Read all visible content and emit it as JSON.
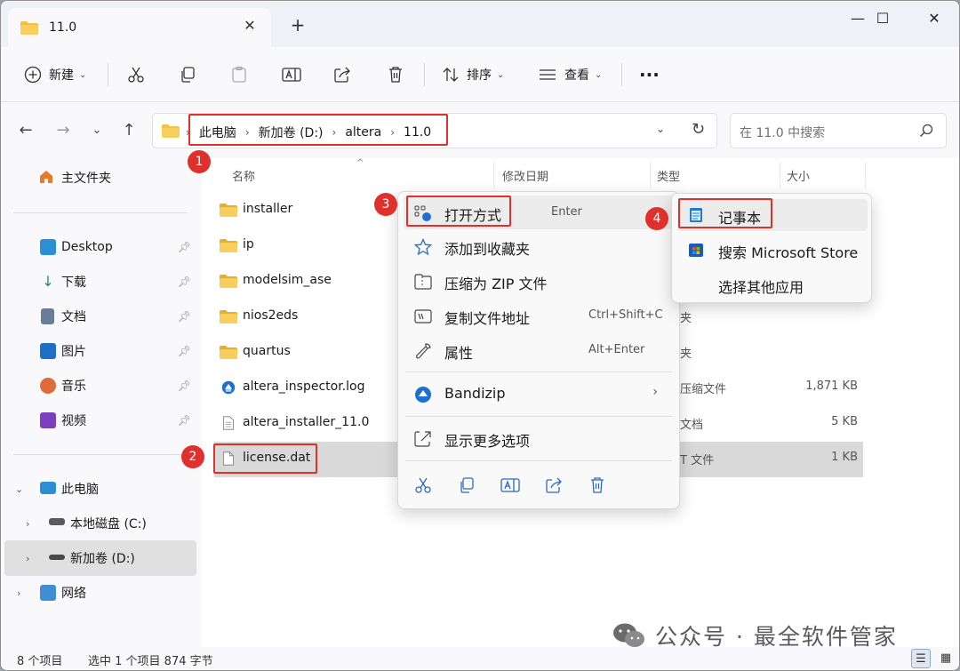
{
  "window": {
    "tab_title": "11.0",
    "new_tab_symbol": "+",
    "controls": {
      "minimize": "—",
      "maximize": "☐",
      "close": "✕"
    }
  },
  "toolbar": {
    "new_label": "新建",
    "sort_label": "排序",
    "view_label": "查看",
    "more_label": "···"
  },
  "address": {
    "crumbs": [
      "此电脑",
      "新加卷 (D:)",
      "altera",
      "11.0"
    ],
    "search_placeholder": "在 11.0 中搜索"
  },
  "sidebar": {
    "home": "主文件夹",
    "quick": [
      {
        "label": "Desktop",
        "icon": "desktop-icon"
      },
      {
        "label": "下载",
        "icon": "download-icon"
      },
      {
        "label": "文档",
        "icon": "documents-icon"
      },
      {
        "label": "图片",
        "icon": "pictures-icon"
      },
      {
        "label": "音乐",
        "icon": "music-icon"
      },
      {
        "label": "视频",
        "icon": "videos-icon"
      }
    ],
    "this_pc": "此电脑",
    "drives": [
      "本地磁盘 (C:)",
      "新加卷 (D:)"
    ],
    "network": "网络"
  },
  "columns": {
    "name": "名称",
    "modified": "修改日期",
    "type": "类型",
    "size": "大小"
  },
  "files": [
    {
      "name": "installer",
      "kind": "folder",
      "type": "",
      "size": ""
    },
    {
      "name": "ip",
      "kind": "folder",
      "type": "",
      "size": ""
    },
    {
      "name": "modelsim_ase",
      "kind": "folder",
      "type": "",
      "size": ""
    },
    {
      "name": "nios2eds",
      "kind": "folder",
      "type": "夹",
      "size": ""
    },
    {
      "name": "quartus",
      "kind": "folder",
      "type": "夹",
      "size": ""
    },
    {
      "name": "altera_inspector.log",
      "kind": "zip",
      "type": "压缩文件",
      "size": "1,871 KB"
    },
    {
      "name": "altera_installer_11.0",
      "kind": "text",
      "type": "文档",
      "size": "5 KB"
    },
    {
      "name": "license.dat",
      "kind": "text",
      "type": "T 文件",
      "size": "1 KB"
    }
  ],
  "context_menu": {
    "open_with": "打开方式",
    "open_with_shortcut": "Enter",
    "add_favorite": "添加到收藏夹",
    "compress_zip": "压缩为 ZIP 文件",
    "copy_path": "复制文件地址",
    "copy_path_shortcut": "Ctrl+Shift+C",
    "properties": "属性",
    "properties_shortcut": "Alt+Enter",
    "bandizip": "Bandizip",
    "more_options": "显示更多选项"
  },
  "submenu": {
    "notepad": "记事本",
    "store": "搜索 Microsoft Store",
    "other_app": "选择其他应用"
  },
  "annotations": [
    "1",
    "2",
    "3",
    "4"
  ],
  "status": {
    "count": "8 个项目",
    "selected": "选中 1 个项目  874 字节"
  },
  "watermark": {
    "text": "公众号 · 最全软件管家"
  },
  "colors": {
    "accent": "#0067c0",
    "annotation": "#e0302c",
    "folder": "#f4c145"
  }
}
